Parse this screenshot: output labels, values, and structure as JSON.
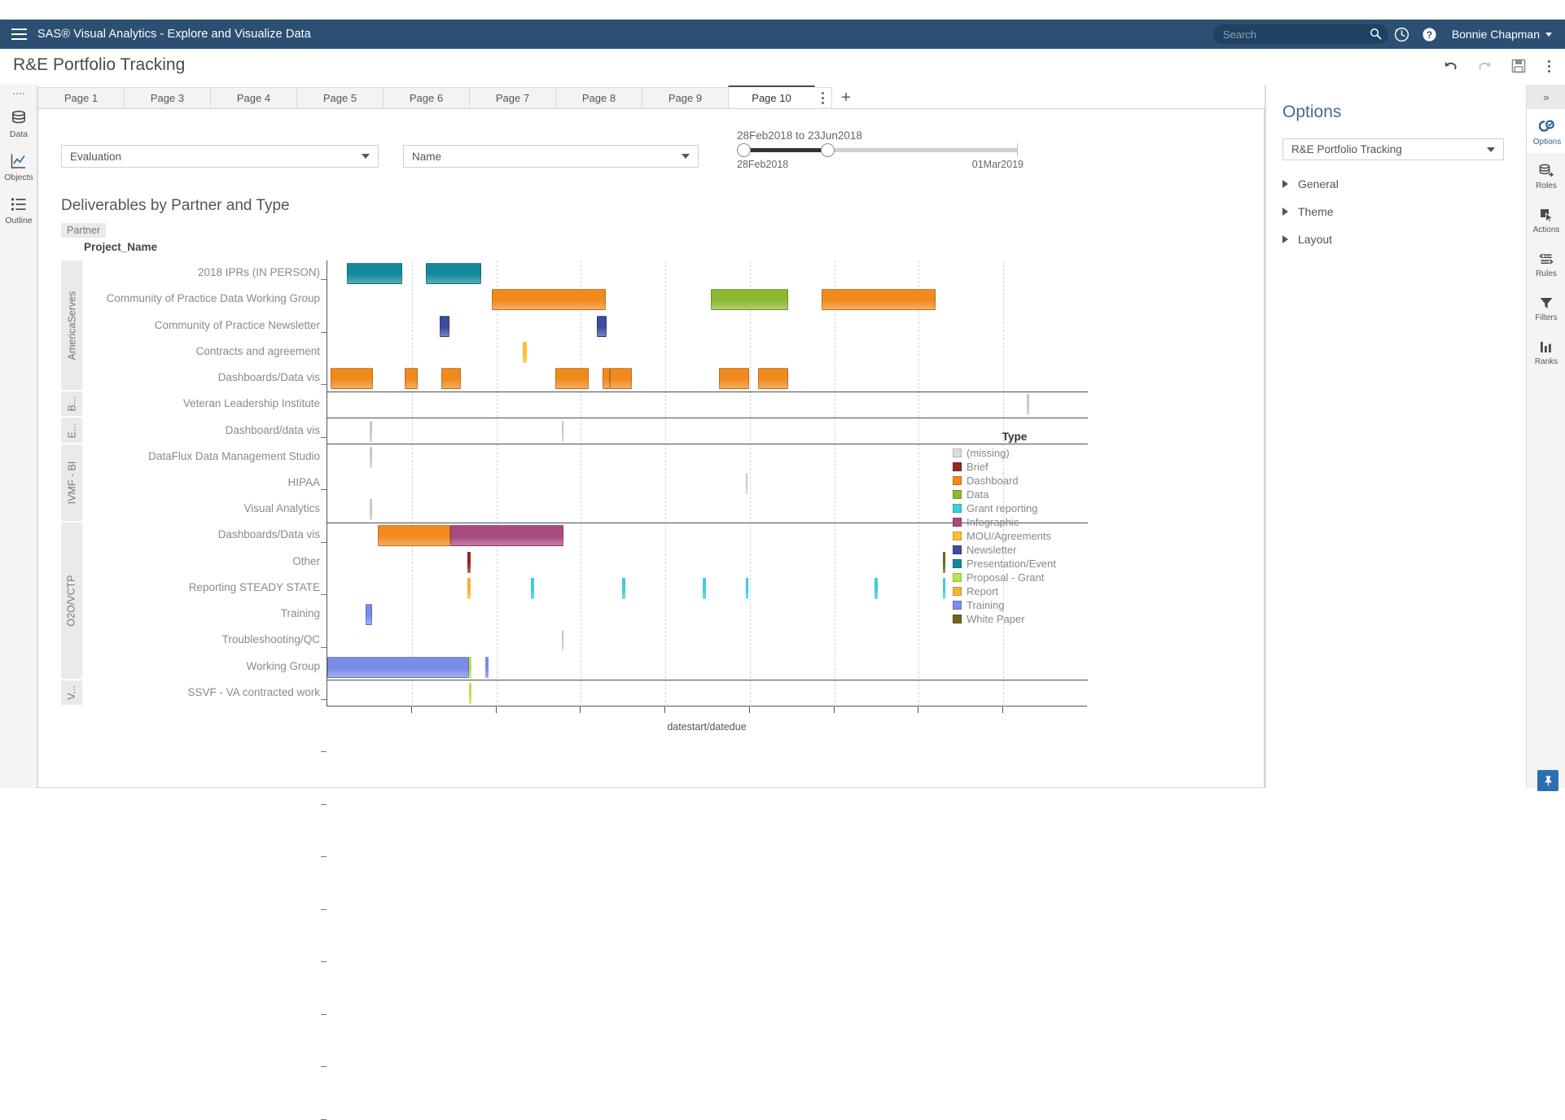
{
  "appbar": {
    "menu_icon": "hamburger-icon",
    "title": "SAS® Visual Analytics - Explore and Visualize Data",
    "search_placeholder": "Search",
    "search_value": "",
    "search_icon": "search-icon",
    "history_icon": "history-icon",
    "help_icon": "help-icon",
    "user_name": "Bonnie Chapman",
    "brand_color": "#2c4f72"
  },
  "report_header": {
    "title": "R&E Portfolio Tracking",
    "tools": [
      {
        "name": "undo-button",
        "label": "Undo"
      },
      {
        "name": "redo-button",
        "label": "Redo"
      },
      {
        "name": "save-button",
        "label": "Save"
      },
      {
        "name": "more-options-button",
        "label": "More"
      }
    ]
  },
  "left_rail": {
    "items": [
      {
        "icon": "data-icon",
        "label": "Data"
      },
      {
        "icon": "objects-icon",
        "label": "Objects"
      },
      {
        "icon": "outline-icon",
        "label": "Outline"
      }
    ]
  },
  "right_rail": {
    "collapse_icon": "chevron-double-right-icon",
    "items": [
      {
        "icon": "options-icon",
        "label": "Options",
        "active": true
      },
      {
        "icon": "roles-icon",
        "label": "Roles",
        "active": false
      },
      {
        "icon": "actions-icon",
        "label": "Actions",
        "active": false
      },
      {
        "icon": "rules-icon",
        "label": "Rules",
        "active": false
      },
      {
        "icon": "filters-icon",
        "label": "Filters",
        "active": false
      },
      {
        "icon": "ranks-icon",
        "label": "Ranks",
        "active": false
      }
    ]
  },
  "tabs": {
    "items": [
      "Page 1",
      "Page 3",
      "Page 4",
      "Page 5",
      "Page 6",
      "Page 7",
      "Page 8",
      "Page 9",
      "Page 10"
    ],
    "active": "Page 10",
    "menu_icon": "tab-menu-icon",
    "add_label": "+"
  },
  "controls": {
    "evaluation_dropdown": "Evaluation",
    "name_dropdown": "Name",
    "slider_label": "28Feb2018 to 23Jun2018",
    "slider_min": "28Feb2018",
    "slider_max": "01Mar2019"
  },
  "options_panel": {
    "title": "Options",
    "selected_object": "R&E Portfolio Tracking",
    "sections": [
      "General",
      "Theme",
      "Layout"
    ]
  },
  "pin_button": {
    "icon": "pin-icon"
  },
  "chart_data": {
    "type": "bar",
    "title": "Deliverables by Partner and Type",
    "subtype": "gantt",
    "xlabel": "datestart/datedue",
    "ylabel": "",
    "group_axis_label": "Partner",
    "category_axis_label": "Project_Name",
    "xlim": [
      "28Feb2018",
      "01Mar2019"
    ],
    "x_tick_labels": [],
    "grid": "vertical-dashed",
    "legend": {
      "title": "Type",
      "position": "right",
      "entries": [
        {
          "label": "(missing)",
          "color": "#dcdcdc"
        },
        {
          "label": "Brief",
          "color": "#8f2b23"
        },
        {
          "label": "Dashboard",
          "color": "#f08a1e"
        },
        {
          "label": "Data",
          "color": "#8cb832"
        },
        {
          "label": "Grant reporting",
          "color": "#3ecbdd"
        },
        {
          "label": "Infographic",
          "color": "#a94a80"
        },
        {
          "label": "MOU/Agreements",
          "color": "#fcbf32"
        },
        {
          "label": "Newsletter",
          "color": "#3b4d9e"
        },
        {
          "label": "Presentation/Event",
          "color": "#13899b"
        },
        {
          "label": "Proposal - Grant",
          "color": "#bbe24a"
        },
        {
          "label": "Report",
          "color": "#f8af3c"
        },
        {
          "label": "Training",
          "color": "#7b8ce8"
        },
        {
          "label": "White Paper",
          "color": "#6e6320"
        }
      ]
    },
    "partners": [
      {
        "name": "AmericaServes",
        "display": "AmericaServes",
        "rows": 5
      },
      {
        "name": "B",
        "display": "B...",
        "rows": 1
      },
      {
        "name": "E",
        "display": "E...",
        "rows": 1
      },
      {
        "name": "IVMF - BI",
        "display": "IVMF - BI",
        "rows": 3
      },
      {
        "name": "O2O/VCTP",
        "display": "O2O/VCTP",
        "rows": 6
      },
      {
        "name": "V",
        "display": "V...",
        "rows": 1
      }
    ],
    "rows": [
      {
        "partner": "AmericaServes",
        "label": "2018 IPRs (IN PERSON)",
        "bars": [
          {
            "type": "Presentation/Event",
            "color": "#13899b",
            "x": 2.6,
            "w": 7.2
          },
          {
            "type": "Presentation/Event",
            "color": "#13899b",
            "x": 13.0,
            "w": 7.2
          }
        ]
      },
      {
        "partner": "AmericaServes",
        "label": "Community of Practice Data Working Group",
        "bars": [
          {
            "type": "Dashboard",
            "color": "#f08a1e",
            "x": 21.6,
            "w": 15.0
          },
          {
            "type": "Data",
            "color": "#8cb832",
            "x": 50.4,
            "w": 10.2
          },
          {
            "type": "Dashboard",
            "color": "#f08a1e",
            "x": 65.0,
            "w": 15.0
          }
        ]
      },
      {
        "partner": "AmericaServes",
        "label": "Community of Practice Newsletter",
        "bars": [
          {
            "type": "Newsletter",
            "color": "#3b4d9e",
            "x": 14.8,
            "w": 1.3
          },
          {
            "type": "Newsletter",
            "color": "#3b4d9e",
            "x": 35.4,
            "w": 1.3
          }
        ]
      },
      {
        "partner": "AmericaServes",
        "label": "Contracts and agreement",
        "bars": [
          {
            "type": "MOU/Agreements",
            "color": "#fcbf32",
            "x": 25.7,
            "w": 0.5
          }
        ]
      },
      {
        "partner": "AmericaServes",
        "label": "Dashboards/Data vis",
        "bars": [
          {
            "type": "Dashboard",
            "color": "#f08a1e",
            "x": 0.4,
            "w": 5.6
          },
          {
            "type": "Dashboard",
            "color": "#f08a1e",
            "x": 10.2,
            "w": 1.7
          },
          {
            "type": "Dashboard",
            "color": "#f08a1e",
            "x": 15.0,
            "w": 2.6
          },
          {
            "type": "Dashboard",
            "color": "#f08a1e",
            "x": 30.0,
            "w": 4.4
          },
          {
            "type": "Dashboard",
            "color": "#f08a1e",
            "x": 36.2,
            "w": 1.0
          },
          {
            "type": "Dashboard",
            "color": "#f08a1e",
            "x": 37.2,
            "w": 2.8
          },
          {
            "type": "Dashboard",
            "color": "#f08a1e",
            "x": 51.5,
            "w": 4.0
          },
          {
            "type": "Dashboard",
            "color": "#f08a1e",
            "x": 56.6,
            "w": 4.0
          }
        ]
      },
      {
        "partner": "B",
        "label": "Veteran Leadership Institute",
        "bars": [
          {
            "type": "(missing)",
            "color": "#c8c8c8",
            "x": 92.0,
            "w": 0.25
          }
        ]
      },
      {
        "partner": "E",
        "label": "Dashboard/data vis",
        "bars": [
          {
            "type": "(missing)",
            "color": "#c8c8c8",
            "x": 5.6,
            "w": 0.25
          },
          {
            "type": "(missing)",
            "color": "#c8c8c8",
            "x": 30.8,
            "w": 0.25
          }
        ]
      },
      {
        "partner": "IVMF - BI",
        "label": "DataFlux Data Management Studio",
        "bars": [
          {
            "type": "(missing)",
            "color": "#c8c8c8",
            "x": 5.6,
            "w": 0.25
          }
        ]
      },
      {
        "partner": "IVMF - BI",
        "label": "HIPAA",
        "bars": [
          {
            "type": "(missing)",
            "color": "#c8c8c8",
            "x": 55.0,
            "w": 0.25
          }
        ]
      },
      {
        "partner": "IVMF - BI",
        "label": "Visual Analytics",
        "bars": [
          {
            "type": "(missing)",
            "color": "#c8c8c8",
            "x": 5.6,
            "w": 0.25
          }
        ]
      },
      {
        "partner": "O2O/VCTP",
        "label": "Dashboards/Data vis",
        "bars": [
          {
            "type": "Dashboard",
            "color": "#f08a1e",
            "x": 6.6,
            "w": 9.6
          },
          {
            "type": "Infographic",
            "color": "#a94a80",
            "x": 16.2,
            "w": 14.9
          }
        ]
      },
      {
        "partner": "O2O/VCTP",
        "label": "Other",
        "bars": [
          {
            "type": "Brief",
            "color": "#8f2b23",
            "x": 18.4,
            "w": 0.4
          },
          {
            "type": "White Paper",
            "color": "#6e6320",
            "x": 80.9,
            "w": 0.4
          }
        ]
      },
      {
        "partner": "O2O/VCTP",
        "label": "Reporting STEADY STATE",
        "bars": [
          {
            "type": "Report",
            "color": "#f8af3c",
            "x": 18.4,
            "w": 0.4
          },
          {
            "type": "Grant reporting",
            "color": "#3ecbdd",
            "x": 26.8,
            "w": 0.4
          },
          {
            "type": "Grant reporting",
            "color": "#3ecbdd",
            "x": 38.8,
            "w": 0.4
          },
          {
            "type": "Grant reporting",
            "color": "#3ecbdd",
            "x": 49.4,
            "w": 0.4
          },
          {
            "type": "Grant reporting",
            "color": "#3ecbdd",
            "x": 55.0,
            "w": 0.4
          },
          {
            "type": "Grant reporting",
            "color": "#3ecbdd",
            "x": 72.0,
            "w": 0.4
          },
          {
            "type": "Grant reporting",
            "color": "#3ecbdd",
            "x": 80.9,
            "w": 0.4
          }
        ]
      },
      {
        "partner": "O2O/VCTP",
        "label": "Training",
        "bars": [
          {
            "type": "Training",
            "color": "#7b8ce8",
            "x": 5.0,
            "w": 0.9
          }
        ]
      },
      {
        "partner": "O2O/VCTP",
        "label": "Troubleshooting/QC",
        "bars": [
          {
            "type": "(missing)",
            "color": "#c8c8c8",
            "x": 30.8,
            "w": 0.3
          }
        ]
      },
      {
        "partner": "O2O/VCTP",
        "label": "Working Group",
        "bars": [
          {
            "type": "Training",
            "color": "#7b8ce8",
            "x": 0.0,
            "w": 18.6
          },
          {
            "type": "Proposal - Grant",
            "color": "#bbe24a",
            "x": 18.6,
            "w": 0.35
          },
          {
            "type": "Training",
            "color": "#7b8ce8",
            "x": 20.8,
            "w": 0.4
          }
        ]
      },
      {
        "partner": "V",
        "label": "SSVF - VA contracted work",
        "bars": [
          {
            "type": "Proposal - Grant",
            "color": "#bbe24a",
            "x": 18.6,
            "w": 0.4
          }
        ]
      }
    ]
  }
}
